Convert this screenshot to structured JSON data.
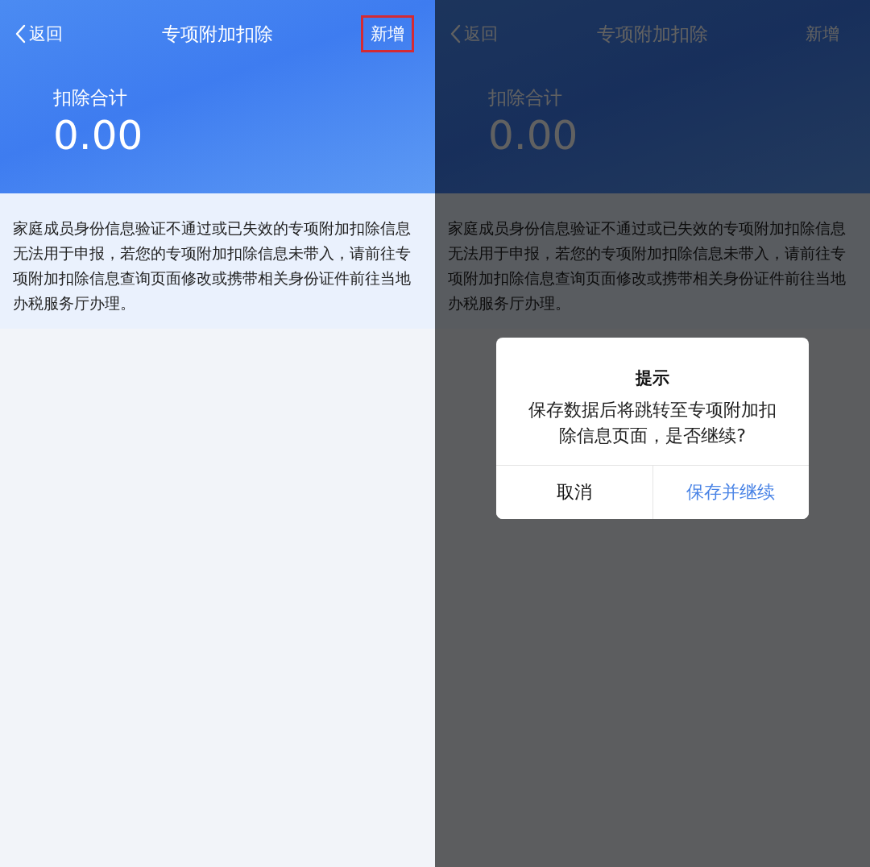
{
  "screens": [
    {
      "back": "返回",
      "title": "专项附加扣除",
      "action": {
        "label": "新增",
        "highlighted": true
      },
      "total_label": "扣除合计",
      "total": "0.00",
      "notice": "家庭成员身份信息验证不通过或已失效的专项附加扣除信息无法用于申报，若您的专项附加扣除信息未带入，请前往专项附加扣除信息查询页面修改或携带相关身份证件前往当地办税服务厅办理。"
    },
    {
      "back": "返回",
      "title": "专项附加扣除",
      "action": {
        "label": "新增",
        "highlighted": false
      },
      "total_label": "扣除合计",
      "total": "0.00",
      "notice": "家庭成员身份信息验证不通过或已失效的专项附加扣除信息无法用于申报，若您的专项附加扣除信息未带入，请前往专项附加扣除信息查询页面修改或携带相关身份证件前往当地办税服务厅办理。",
      "dimmed": true,
      "dialog": {
        "title": "提示",
        "message": "保存数据后将跳转至专项附加扣除信息页面，是否继续?",
        "buttons": [
          {
            "label": "取消",
            "kind": "cancel"
          },
          {
            "label": "保存并继续",
            "kind": "confirm"
          }
        ]
      }
    }
  ]
}
